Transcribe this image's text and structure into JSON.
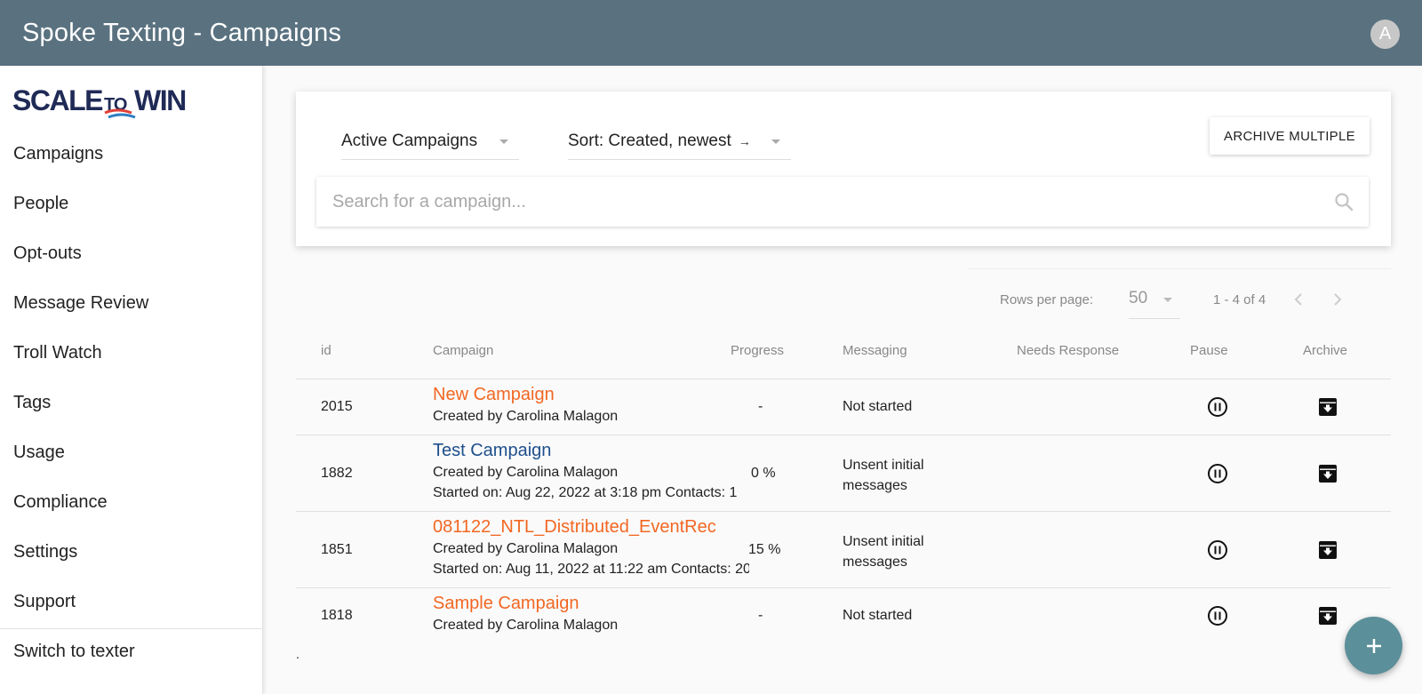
{
  "appbar": {
    "title": "Spoke Texting - Campaigns",
    "avatar_letter": "A"
  },
  "sidebar": {
    "logo_text": "SCALE TO WIN",
    "items": [
      {
        "label": "Campaigns"
      },
      {
        "label": "People"
      },
      {
        "label": "Opt-outs"
      },
      {
        "label": "Message Review"
      },
      {
        "label": "Troll Watch"
      },
      {
        "label": "Tags"
      },
      {
        "label": "Usage"
      },
      {
        "label": "Compliance"
      },
      {
        "label": "Settings"
      },
      {
        "label": "Support"
      }
    ],
    "switch_label": "Switch to texter"
  },
  "filters": {
    "status_select": "Active Campaigns",
    "sort_select": "Sort: Created, newest",
    "sort_arrow": "→",
    "archive_multiple_label": "ARCHIVE MULTIPLE",
    "search_placeholder": "Search for a campaign..."
  },
  "pagination": {
    "rows_per_page_label": "Rows per page:",
    "rows_per_page_value": "50",
    "range": "1 - 4 of 4"
  },
  "table": {
    "headers": {
      "id": "id",
      "campaign": "Campaign",
      "progress": "Progress",
      "messaging": "Messaging",
      "needs_response": "Needs Response",
      "pause": "Pause",
      "archive": "Archive"
    },
    "rows": [
      {
        "id": "2015",
        "name": "New Campaign",
        "name_color": "#f26722",
        "created_by": "Created by Carolina Malagon",
        "started": "",
        "progress": "-",
        "messaging": "Not started",
        "needs_response": ""
      },
      {
        "id": "1882",
        "name": "Test Campaign",
        "name_color": "#1e4f8c",
        "created_by": "Created by Carolina Malagon",
        "started": "Started on: Aug 22, 2022 at 3:18 pm Contacts: 1",
        "progress": "0 %",
        "messaging": "Unsent initial messages",
        "needs_response": ""
      },
      {
        "id": "1851",
        "name": "081122_NTL_Distributed_EventRec",
        "name_color": "#f26722",
        "created_by": "Created by Carolina Malagon",
        "started": "Started on: Aug 11, 2022 at 11:22 am Contacts: 20",
        "progress": "15 %",
        "messaging": "Unsent initial messages",
        "needs_response": ""
      },
      {
        "id": "1818",
        "name": "Sample Campaign",
        "name_color": "#f26722",
        "created_by": "Created by Carolina Malagon",
        "started": "",
        "progress": "-",
        "messaging": "Not started",
        "needs_response": ""
      }
    ]
  },
  "footer_dot": ".",
  "colors": {
    "appbar": "#5a7280",
    "accent_orange": "#f26722",
    "link_blue": "#1e4f8c",
    "fab": "#5b8f9a"
  },
  "icons": [
    "search-icon",
    "chevron-left-icon",
    "chevron-right-icon",
    "pause-circle-icon",
    "archive-icon",
    "plus-icon",
    "arrow-right-icon",
    "dropdown-caret-icon"
  ]
}
